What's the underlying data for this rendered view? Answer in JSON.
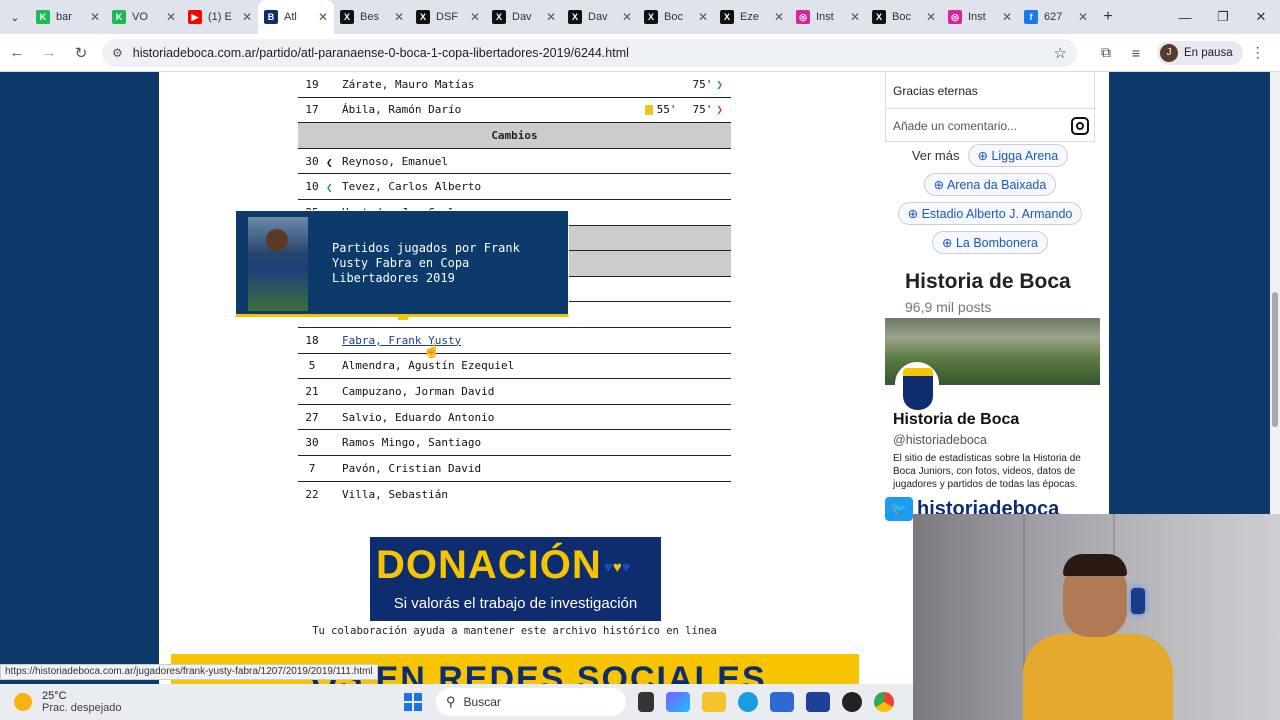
{
  "browser": {
    "tabs": [
      {
        "title": "bar",
        "color": "#1db954",
        "glyph": "K"
      },
      {
        "title": "VO",
        "color": "#1db954",
        "glyph": "K"
      },
      {
        "title": "(1) E",
        "color": "#ff0000",
        "glyph": "▶"
      },
      {
        "title": "Atl",
        "color": "#0d2d6e",
        "glyph": "B",
        "active": true
      },
      {
        "title": "Bes",
        "color": "#111111",
        "glyph": "X"
      },
      {
        "title": "DSF",
        "color": "#111111",
        "glyph": "X"
      },
      {
        "title": "Dav",
        "color": "#111111",
        "glyph": "X"
      },
      {
        "title": "Dav",
        "color": "#111111",
        "glyph": "X"
      },
      {
        "title": "Boc",
        "color": "#111111",
        "glyph": "X"
      },
      {
        "title": "Eze",
        "color": "#111111",
        "glyph": "X"
      },
      {
        "title": "Inst",
        "color": "#d6249f",
        "glyph": "◎"
      },
      {
        "title": "Boc",
        "color": "#111111",
        "glyph": "X"
      },
      {
        "title": "Inst",
        "color": "#d6249f",
        "glyph": "◎"
      },
      {
        "title": "627",
        "color": "#1877f2",
        "glyph": "f"
      }
    ],
    "url": "historiadeboca.com.ar/partido/atl-paranaense-0-boca-1-copa-libertadores-2019/6244.html",
    "profile_initial": "J",
    "profile_label": "En pausa",
    "status_url": "https://historiadeboca.com.ar/jugadores/frank-yusty-fabra/1207/2019/2019/111.html"
  },
  "table": {
    "top_rows": [
      {
        "num": "19",
        "name": "Zárate, Mauro Matías",
        "min": "75'",
        "arrow": "green",
        "card": false
      },
      {
        "num": "17",
        "name": "Ábila, Ramón Darío",
        "card_min": "55'",
        "min": "75'",
        "arrow": "red",
        "card": true
      }
    ],
    "cambios_header": "Cambios",
    "cambios": [
      {
        "num": "30",
        "name": "Reynoso, Emanuel",
        "arrow": "black"
      },
      {
        "num": "10",
        "name": "Tevez, Carlos Alberto",
        "arrow": "green"
      },
      {
        "num": "25",
        "name": "Hurtado, Jan Carlos",
        "arrow": "red"
      }
    ],
    "bottom_rows": [
      {
        "num": "18",
        "name": "Fabra, Frank Yusty",
        "link": true
      },
      {
        "num": "5",
        "name": "Almendra, Agustín Ezequiel"
      },
      {
        "num": "21",
        "name": "Campuzano, Jorman David"
      },
      {
        "num": "27",
        "name": "Salvio, Eduardo Antonio"
      },
      {
        "num": "30",
        "name": "Ramos Mingo, Santiago"
      },
      {
        "num": "7",
        "name": "Pavón, Cristian David"
      },
      {
        "num": "22",
        "name": "Villa, Sebastián"
      }
    ]
  },
  "tooltip": {
    "text": "Partidos jugados por Frank Yusty Fabra en Copa Libertadores 2019"
  },
  "donacion": {
    "title": "DONACIÓN",
    "subtitle": "Si valorás el trabajo de investigación",
    "caption": "Tu colaboración ayuda a mantener este archivo histórico en línea"
  },
  "footer_banner": "OS EN REDES SOCIALES",
  "sidebar": {
    "ig_caption": "Gracias eternas",
    "comment_placeholder": "Añade un comentario...",
    "ver_mas": "Ver más",
    "chips": [
      "Ligga Arena",
      "Arena da Baixada",
      "Estadio Alberto J. Armando",
      "La Bombonera"
    ],
    "profile_title": "Historia de Boca",
    "profile_posts": "96,9 mil posts",
    "profile_name": "Historia de Boca",
    "profile_handle": "@historiadeboca",
    "profile_desc": "El sitio de estadísticas sobre la Historia de Boca Juniors, con fotos, videos, datos de jugadores y partidos de todas las épocas.",
    "twitter_text": "historiadeboca"
  },
  "taskbar": {
    "temp": "25°C",
    "weather": "Prac. despejado",
    "search": "Buscar"
  }
}
